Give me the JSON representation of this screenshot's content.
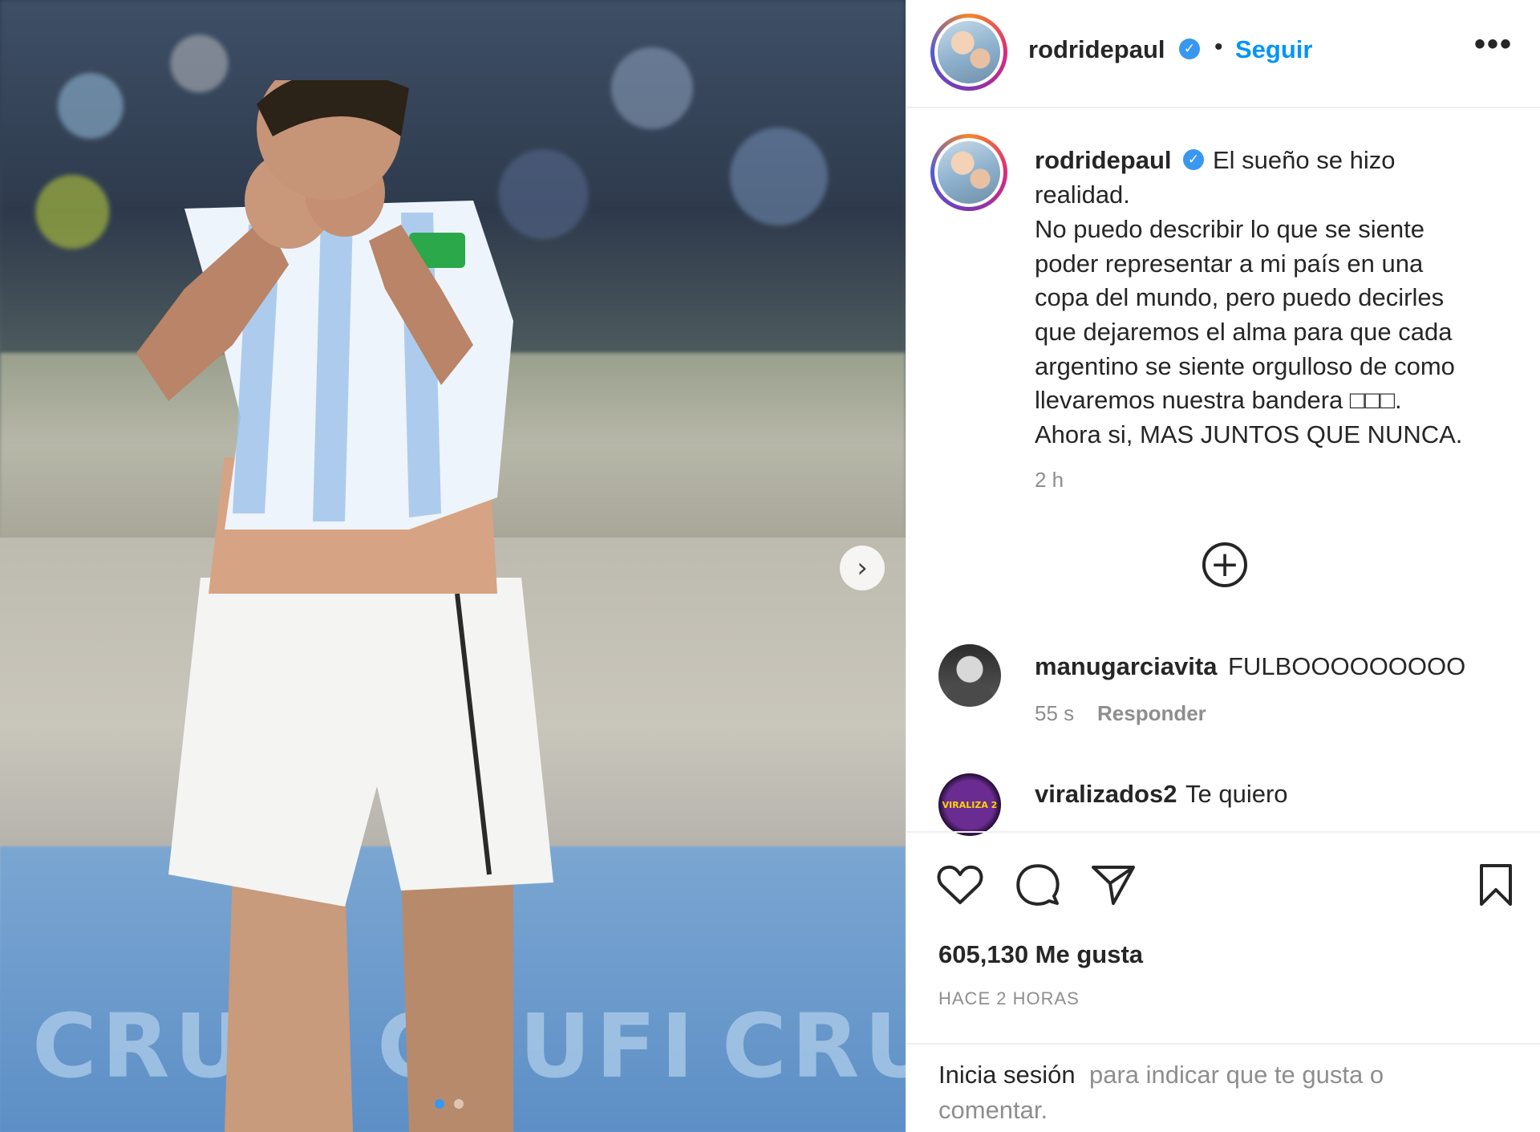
{
  "post": {
    "author": "rodridepaul",
    "follow_label": "Seguir",
    "bullet": "•",
    "more_label": "•••",
    "verified_mark": "✓"
  },
  "caption": {
    "user": "rodridepaul",
    "first_line": "El sueño se hizo",
    "lines": [
      "realidad.",
      "No puedo describir lo que se siente",
      "poder representar a mi país en una",
      "copa del mundo, pero puedo decirles",
      "que dejaremos el alma para que cada",
      "argentino se siente orgulloso de como",
      "llevaremos nuestra bandera □□□.",
      "Ahora si, MAS JUNTOS QUE NUNCA."
    ],
    "time": "2 h"
  },
  "comments": [
    {
      "user": "manugarciavita",
      "text": "FULBOOOOOOOOO",
      "time": "55 s",
      "reply": "Responder"
    },
    {
      "user": "viralizados2",
      "text": "Te quiero",
      "avatar_text": "VIRALIZA 2"
    }
  ],
  "actions": {
    "icons": [
      "heart-icon",
      "comment-icon",
      "share-icon",
      "bookmark-icon"
    ],
    "likes": "605,130 Me gusta",
    "posted": "HACE 2 HORAS"
  },
  "login": {
    "link": "Inicia sesión",
    "rest_line1": "para indicar que te gusta o",
    "rest_line2": "comentar."
  },
  "photo": {
    "board_text": "CRUFI",
    "next_label": "›",
    "carousel_count": 2,
    "carousel_active": 1
  },
  "colors": {
    "accent": "#0095f6",
    "verified": "#3897f0",
    "muted": "#8e8e8e",
    "text": "#262626"
  }
}
